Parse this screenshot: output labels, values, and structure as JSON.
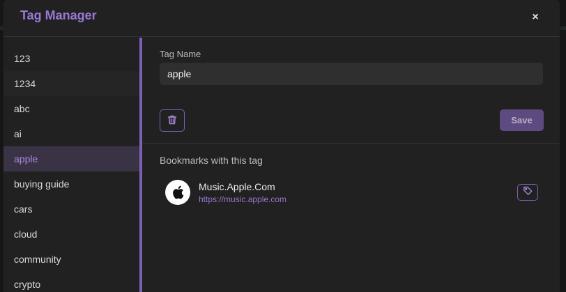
{
  "modal": {
    "title": "Tag Manager",
    "close_label": "×"
  },
  "sidebar": {
    "tags": [
      {
        "label": "123",
        "state": "normal"
      },
      {
        "label": "1234",
        "state": "hover"
      },
      {
        "label": "abc",
        "state": "normal"
      },
      {
        "label": "ai",
        "state": "normal"
      },
      {
        "label": "apple",
        "state": "active"
      },
      {
        "label": "buying guide",
        "state": "normal"
      },
      {
        "label": "cars",
        "state": "normal"
      },
      {
        "label": "cloud",
        "state": "normal"
      },
      {
        "label": "community",
        "state": "normal"
      },
      {
        "label": "crypto",
        "state": "normal"
      }
    ]
  },
  "editor": {
    "field_label": "Tag Name",
    "tag_name_value": "apple",
    "delete_icon": "trash-icon",
    "save_label": "Save"
  },
  "bookmarks": {
    "section_title": "Bookmarks with this tag",
    "items": [
      {
        "title": "Music.Apple.Com",
        "url": "https://music.apple.com",
        "favicon": "apple-logo-icon",
        "action_icon": "tag-icon"
      }
    ]
  },
  "colors": {
    "accent": "#7e5fb6",
    "title": "#9a78d6",
    "active_bg": "#3a3346",
    "save_bg": "#5d4a80"
  }
}
